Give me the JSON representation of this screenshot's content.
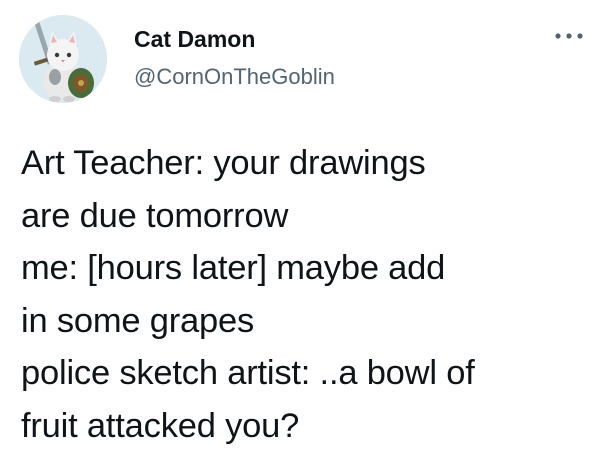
{
  "author": {
    "display_name": "Cat Damon",
    "handle": "@CornOnTheGoblin",
    "avatar_icon": "cat-knight-avatar"
  },
  "menu": {
    "icon": "more-horizontal-icon"
  },
  "tweet": {
    "lines": [
      "Art Teacher: your drawings",
      "are due tomorrow",
      "me: [hours later] maybe add",
      "in some grapes",
      "police sketch artist: ..a bowl of",
      "fruit attacked you?"
    ]
  },
  "colors": {
    "text": "#0f1419",
    "secondary": "#536471",
    "background": "#ffffff"
  }
}
